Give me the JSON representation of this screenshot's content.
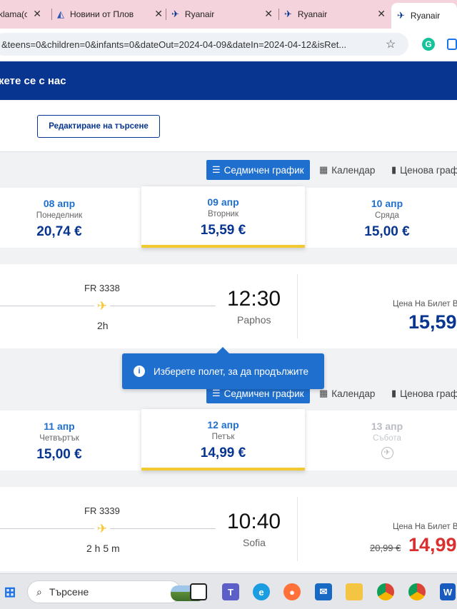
{
  "browser": {
    "tabs": [
      {
        "title": "klama(c",
        "close": "✕"
      },
      {
        "title": "Новини от Плов",
        "close": "✕"
      },
      {
        "title": "Ryanair",
        "close": "✕"
      },
      {
        "title": "Ryanair",
        "close": "✕"
      },
      {
        "title": "Ryanair",
        "close": ""
      }
    ],
    "url": "&teens=0&children=0&infants=0&dateOut=2024-04-09&dateIn=2024-04-12&isRet..."
  },
  "header": {
    "contact": "кете се с нас"
  },
  "search": {
    "edit_label": "Редактиране на търсене"
  },
  "views": {
    "weekly": "Седмичен график",
    "calendar": "Календар",
    "price": "Ценова граф"
  },
  "outbound": {
    "dates": [
      {
        "date": "08 апр",
        "weekday": "Понеделник",
        "price": "20,74 €"
      },
      {
        "date": "09 апр",
        "weekday": "Вторник",
        "price": "15,59 €"
      },
      {
        "date": "10 апр",
        "weekday": "Сряда",
        "price": "15,00 €"
      }
    ],
    "flight": {
      "number": "FR 3338",
      "duration": "2h",
      "time": "12:30",
      "city": "Paphos",
      "price_label": "Цена На Билет В",
      "price": "15,59"
    }
  },
  "tooltip": {
    "text": "Изберете полет, за да продължите"
  },
  "inbound": {
    "dates": [
      {
        "date": "11 апр",
        "weekday": "Четвъртък",
        "price": "15,00 €"
      },
      {
        "date": "12 апр",
        "weekday": "Петък",
        "price": "14,99 €"
      },
      {
        "date": "13 апр",
        "weekday": "Събота",
        "price": ""
      }
    ],
    "flight": {
      "number": "FR 3339",
      "duration": "2 h 5 m",
      "time": "10:40",
      "city": "Sofia",
      "price_label": "Цена На Билет В",
      "old_price": "20,99 €",
      "price": "14,99"
    }
  },
  "taskbar": {
    "search": "Търсене"
  },
  "colors": {
    "brand": "#073590",
    "accent": "#1f6fce",
    "highlight": "#f1c931",
    "sale": "#d92f2f"
  }
}
